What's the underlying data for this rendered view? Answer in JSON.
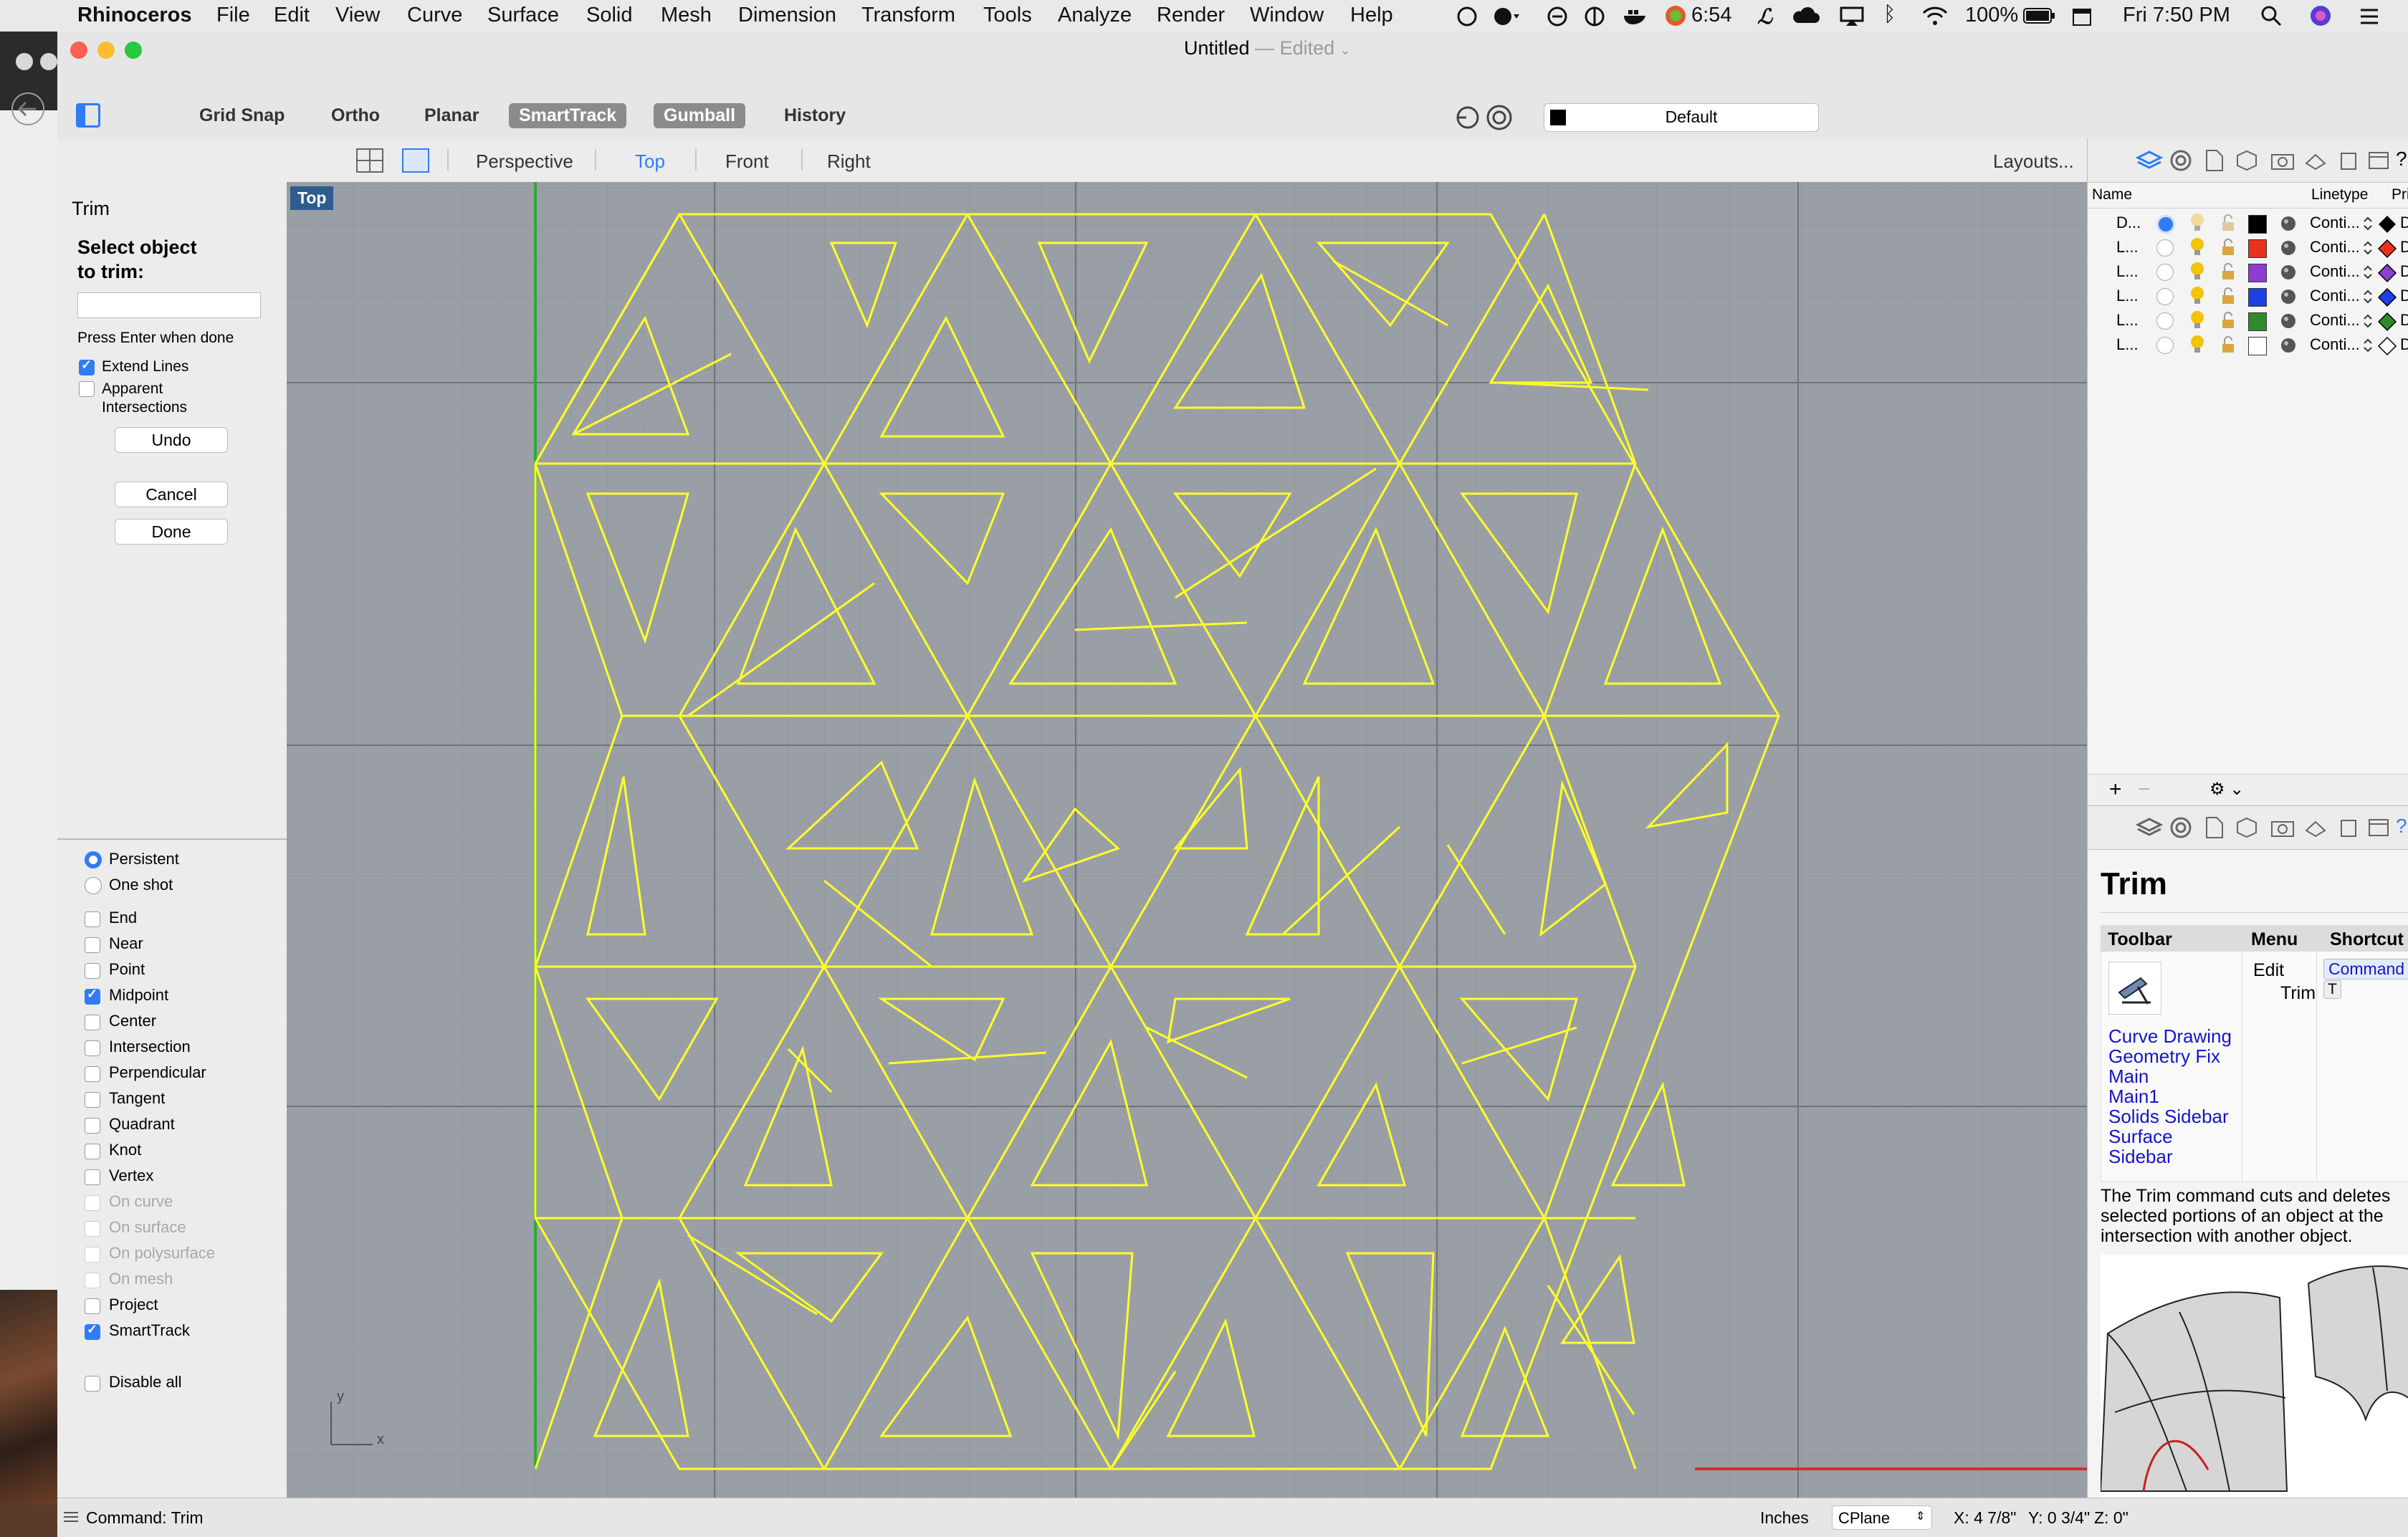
{
  "menubar": {
    "app": "Rhinoceros",
    "items": [
      "File",
      "Edit",
      "View",
      "Curve",
      "Surface",
      "Solid",
      "Mesh",
      "Dimension",
      "Transform",
      "Tools",
      "Analyze",
      "Render",
      "Window",
      "Help"
    ],
    "status_time_badge": "6:54",
    "battery": "100%",
    "clock": "Fri 7:50 PM"
  },
  "window": {
    "title": "Untitled",
    "title_state": "— Edited"
  },
  "toolbar": {
    "buttons": [
      {
        "label": "Grid Snap",
        "active": false
      },
      {
        "label": "Ortho",
        "active": false
      },
      {
        "label": "Planar",
        "active": false
      },
      {
        "label": "SmartTrack",
        "active": true
      },
      {
        "label": "Gumball",
        "active": true
      },
      {
        "label": "History",
        "active": false
      }
    ],
    "layer": "Default"
  },
  "viewport_tabs": {
    "tabs": [
      {
        "label": "Perspective",
        "active": false
      },
      {
        "label": "Top",
        "active": true
      },
      {
        "label": "Front",
        "active": false
      },
      {
        "label": "Right",
        "active": false
      }
    ],
    "layouts": "Layouts..."
  },
  "viewport": {
    "label": "Top",
    "axis_x": "x",
    "axis_y": "y"
  },
  "command_panel": {
    "title": "Trim",
    "prompt": "Select object to trim:",
    "input_value": "",
    "hint": "Press Enter when done",
    "options": [
      {
        "label": "Extend Lines",
        "checked": true
      },
      {
        "label": "Apparent Intersections",
        "checked": false
      }
    ],
    "undo": "Undo",
    "cancel": "Cancel",
    "done": "Done"
  },
  "osnap": {
    "modes": [
      {
        "label": "Persistent",
        "selected": true
      },
      {
        "label": "One shot",
        "selected": false
      }
    ],
    "snaps": [
      {
        "label": "End",
        "checked": false,
        "enabled": true
      },
      {
        "label": "Near",
        "checked": false,
        "enabled": true
      },
      {
        "label": "Point",
        "checked": false,
        "enabled": true
      },
      {
        "label": "Midpoint",
        "checked": true,
        "enabled": true
      },
      {
        "label": "Center",
        "checked": false,
        "enabled": true
      },
      {
        "label": "Intersection",
        "checked": false,
        "enabled": true
      },
      {
        "label": "Perpendicular",
        "checked": false,
        "enabled": true
      },
      {
        "label": "Tangent",
        "checked": false,
        "enabled": true
      },
      {
        "label": "Quadrant",
        "checked": false,
        "enabled": true
      },
      {
        "label": "Knot",
        "checked": false,
        "enabled": true
      },
      {
        "label": "Vertex",
        "checked": false,
        "enabled": true
      },
      {
        "label": "On curve",
        "checked": false,
        "enabled": false
      },
      {
        "label": "On surface",
        "checked": false,
        "enabled": false
      },
      {
        "label": "On polysurface",
        "checked": false,
        "enabled": false
      },
      {
        "label": "On mesh",
        "checked": false,
        "enabled": false
      },
      {
        "label": "Project",
        "checked": false,
        "enabled": true
      },
      {
        "label": "SmartTrack",
        "checked": true,
        "enabled": true
      }
    ],
    "disable_all": "Disable all"
  },
  "layers": {
    "col_name": "Name",
    "col_linetype": "Linetype",
    "col_print": "Pri",
    "rows": [
      {
        "name": "D...",
        "current": true,
        "color": "#000000",
        "linetype": "Conti...",
        "print": "De"
      },
      {
        "name": "L...",
        "current": false,
        "color": "#e8321e",
        "linetype": "Conti...",
        "print": "De"
      },
      {
        "name": "L...",
        "current": false,
        "color": "#8a3fd0",
        "linetype": "Conti...",
        "print": "De"
      },
      {
        "name": "L...",
        "current": false,
        "color": "#1c3fe6",
        "linetype": "Conti...",
        "print": "De"
      },
      {
        "name": "L...",
        "current": false,
        "color": "#2d8a2d",
        "linetype": "Conti...",
        "print": "De"
      },
      {
        "name": "L...",
        "current": false,
        "color": "#ffffff",
        "linetype": "Conti...",
        "print": "De"
      }
    ],
    "add": "+",
    "remove": "−"
  },
  "help": {
    "title": "Trim",
    "col_toolbar": "Toolbar",
    "col_menu": "Menu",
    "col_shortcut": "Shortcut",
    "menu_path_1": "Edit",
    "menu_path_2": "Trim",
    "shortcut": "Command ⌘",
    "shortcut_key": "T",
    "toolbars": [
      "Curve Drawing",
      "Geometry Fix",
      "Main",
      "Main1",
      "Solids Sidebar",
      "Surface",
      "Sidebar"
    ],
    "description": "The Trim command cuts and deletes selected portions of an object at the intersection with another object."
  },
  "statusbar": {
    "command": "Command: Trim",
    "units": "Inches",
    "cplane": "CPlane",
    "x": "X: 4 7/8\"",
    "y": "Y: 0 3/4\"",
    "z": "Z: 0\""
  }
}
